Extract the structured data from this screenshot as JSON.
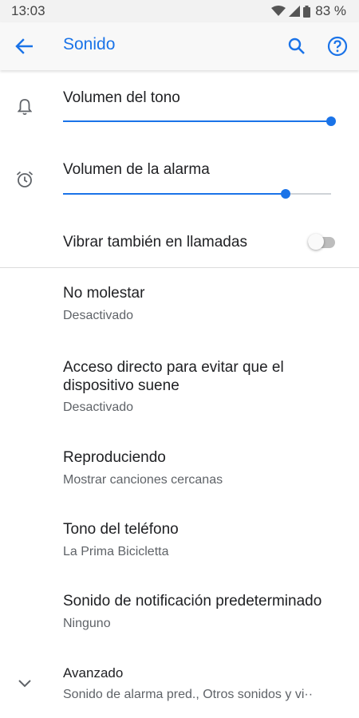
{
  "status_bar": {
    "time": "13:03",
    "battery": "83 %",
    "icons": [
      "wifi-icon",
      "signal-icon",
      "battery-icon"
    ]
  },
  "app_bar": {
    "title": "Sonido",
    "back_icon": "arrow-back-icon",
    "search_icon": "search-icon",
    "help_icon": "help-icon"
  },
  "volume": {
    "ring": {
      "label": "Volumen del tono",
      "icon": "bell-icon",
      "level": 1.0
    },
    "alarm": {
      "label": "Volumen de la alarma",
      "icon": "alarm-clock-icon",
      "level": 0.83
    },
    "vibrate": {
      "label": "Vibrar también en llamadas",
      "enabled": false
    }
  },
  "settings": [
    {
      "title": "No molestar",
      "summary": "Desactivado"
    },
    {
      "title_line1": "Acceso directo para evitar que el",
      "title_line2": "dispositivo suene",
      "summary": "Desactivado"
    },
    {
      "title": "Reproduciendo",
      "summary": "Mostrar canciones cercanas"
    },
    {
      "title": "Tono del teléfono",
      "summary": "La Prima Bicicletta"
    },
    {
      "title": "Sonido de notificación predeterminado",
      "summary": "Ninguno"
    },
    {
      "title": "Avanzado",
      "summary": "Sonido de alarma pred., Otros sonidos y vi··",
      "icon": "chevron-down-icon"
    }
  ],
  "colors": {
    "accent": "#1a73e8",
    "text_primary": "#202124",
    "text_secondary": "#5f6368"
  }
}
